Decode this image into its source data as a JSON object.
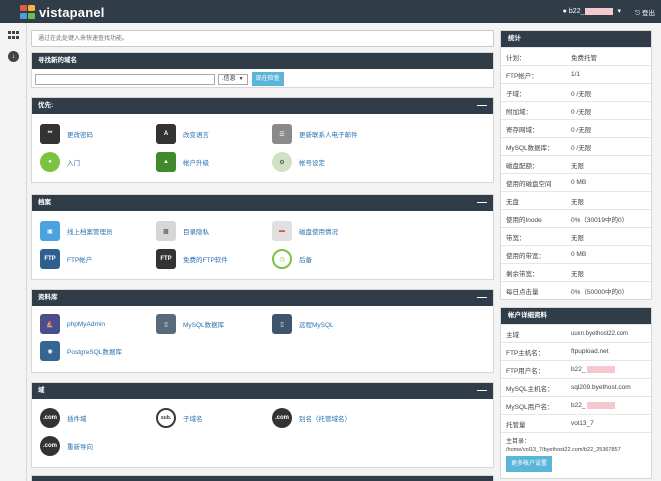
{
  "topbar": {
    "logo_text": "vistapanel",
    "username": "b22_",
    "logout_label": "登出"
  },
  "search": {
    "placeholder": "通过在此处键入来快速查找功能。"
  },
  "domain_finder": {
    "title": "寻找新的域名",
    "tld_value": ".信息",
    "check_label": "现在检查"
  },
  "sections": {
    "priority": {
      "title": "优先:",
      "items": [
        {
          "label": "更改密码"
        },
        {
          "label": "改变语言"
        },
        {
          "label": "更新联系人电子邮件"
        },
        {
          "label": "入门"
        },
        {
          "label": "帐户升级"
        },
        {
          "label": "帐号设定"
        }
      ]
    },
    "files": {
      "title": "档案",
      "items": [
        {
          "label": "线上档案管理员"
        },
        {
          "label": "目录隐私"
        },
        {
          "label": "磁盘使用情况"
        },
        {
          "label": "FTP帐户"
        },
        {
          "label": "免费的FTP软件"
        },
        {
          "label": "后备"
        }
      ]
    },
    "databases": {
      "title": "资料库",
      "items": [
        {
          "label": "phpMyAdmin"
        },
        {
          "label": "MySQL数据库"
        },
        {
          "label": "远程MySQL"
        },
        {
          "label": "PostgreSQL数据库"
        }
      ]
    },
    "domains": {
      "title": "域",
      "items": [
        {
          "label": "插件域",
          "icon_text": ".com"
        },
        {
          "label": "子域名",
          "icon_text": "sub."
        },
        {
          "label": "别名（托管域名）",
          "icon_text": ".com"
        },
        {
          "label": "重新导向",
          "icon_text": ".com"
        }
      ]
    }
  },
  "stats": {
    "title": "统计",
    "rows": [
      {
        "k": "计划：",
        "v": "免费托管"
      },
      {
        "k": "FTP帐户：",
        "v": "1/1"
      },
      {
        "k": "子域：",
        "v": "0 /无限"
      },
      {
        "k": "附加域：",
        "v": "0 /无限"
      },
      {
        "k": "寄存网域：",
        "v": "0 /无限"
      },
      {
        "k": "MySQL数据库：",
        "v": "0 /无限"
      },
      {
        "k": "磁盘配额：",
        "v": "无限"
      },
      {
        "k": "使用的磁盘空间",
        "v": "0 MB"
      },
      {
        "k": "无盘",
        "v": "无限"
      },
      {
        "k": "使用的Inode",
        "v": "0%（30019中的0）"
      },
      {
        "k": "带宽：",
        "v": "无限"
      },
      {
        "k": "使用的带宽：",
        "v": "0 MB"
      },
      {
        "k": "剩余带宽：",
        "v": "无限"
      },
      {
        "k": "每日点击量",
        "v": "0%（50000中的0）"
      }
    ]
  },
  "account": {
    "title": "帐户详细资料",
    "rows": [
      {
        "k": "主域",
        "v": "uuxn.byethost22.com"
      },
      {
        "k": "FTP主机名：",
        "v": "ftpupload.net"
      },
      {
        "k": "FTP用户名：",
        "v": "b22_"
      },
      {
        "k": "MySQL主机名：",
        "v": "sql209.byethost.com"
      },
      {
        "k": "MySQL用户名：",
        "v": "b22_"
      },
      {
        "k": "托管量",
        "v": "vol13_7"
      }
    ],
    "home_label": "主目录：",
    "home_value": "/home/vol13_7/byethost22.com/b22_25367857",
    "more_label": "更多帐户设置"
  },
  "colors": {
    "topbar": "#303c48",
    "accent": "#5bb5d8",
    "link": "#2a72b0"
  }
}
